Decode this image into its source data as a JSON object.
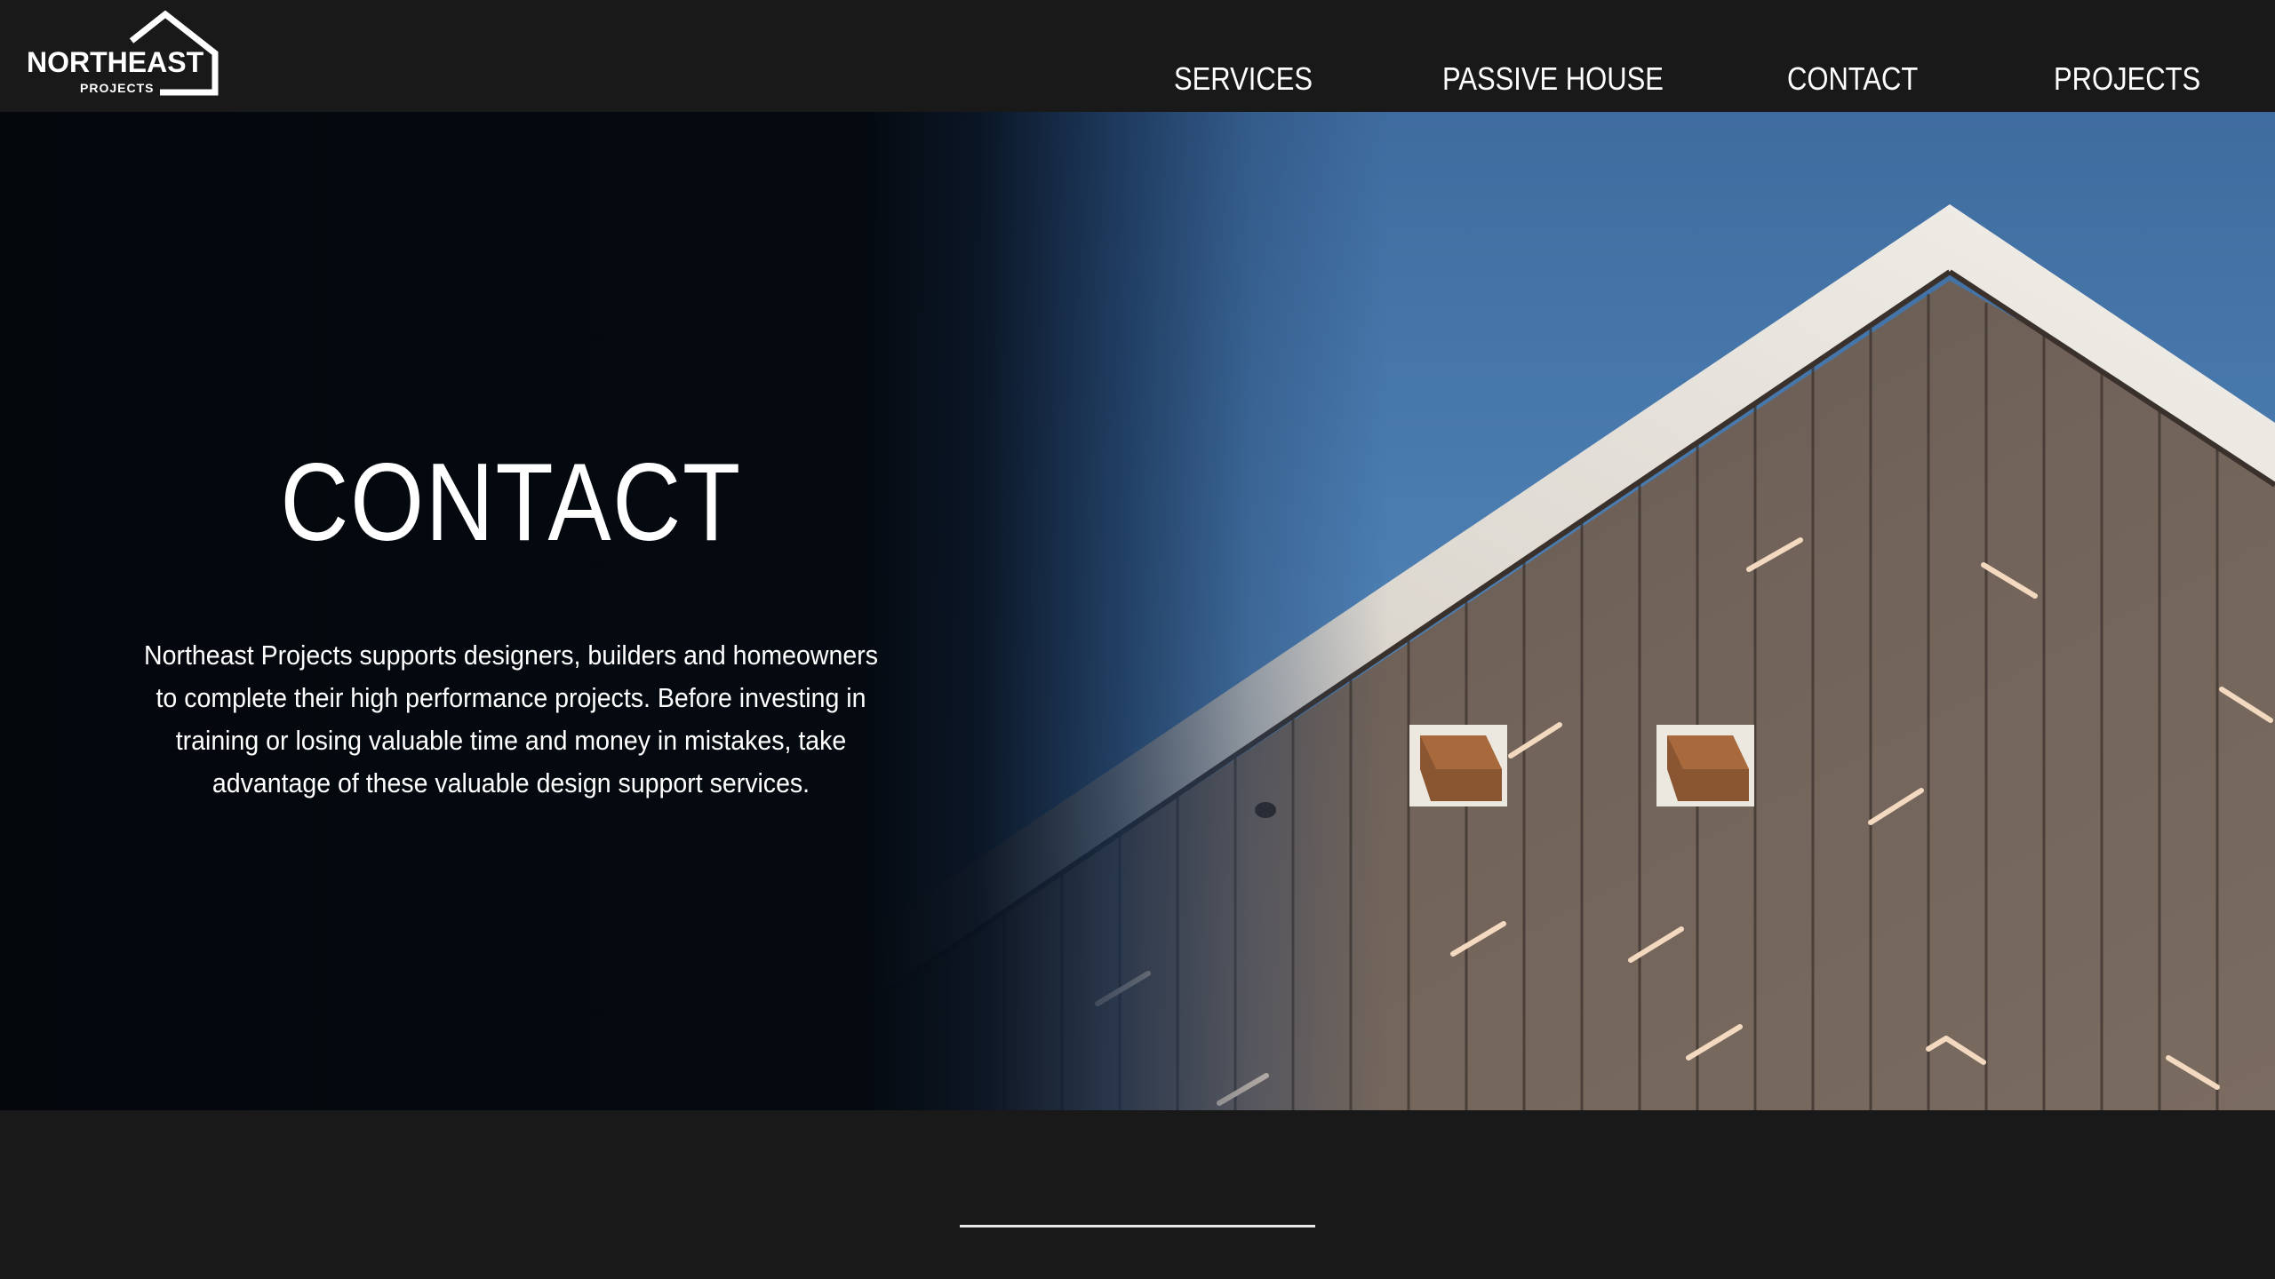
{
  "brand": {
    "name": "NORTHEAST",
    "sub": "PROJECTS"
  },
  "nav": {
    "items": [
      {
        "label": "SERVICES"
      },
      {
        "label": "PASSIVE HOUSE"
      },
      {
        "label": "CONTACT"
      },
      {
        "label": "PROJECTS"
      }
    ]
  },
  "hero": {
    "title": "CONTACT",
    "body": "Northeast Projects supports designers, builders and homeowners to complete their high performance projects. Before investing in training or losing valuable time and money in mistakes, take advantage of these valuable design support services."
  },
  "colors": {
    "header_bg": "#1a1919",
    "sky": "#4a7cb0",
    "siding": "#6f6259",
    "trim": "#e9e4dc"
  }
}
